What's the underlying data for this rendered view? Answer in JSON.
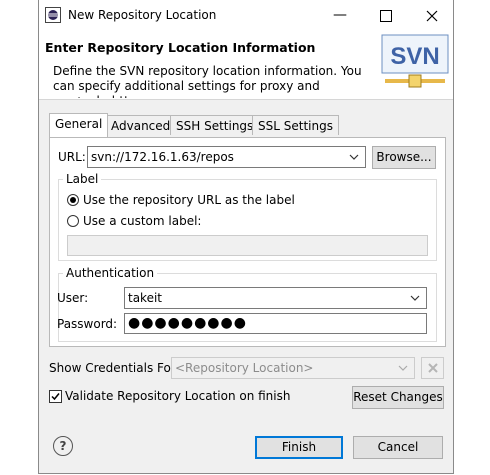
{
  "window": {
    "title": "New Repository Location",
    "minimize_glyph": "—",
    "maximize_glyph": "☐",
    "close_glyph": "✕"
  },
  "header": {
    "title": "Enter Repository Location Information",
    "description": "Define the SVN repository location information. You can specify additional settings for proxy and svn+ssh, https",
    "logo_text": "SVN"
  },
  "tabs": [
    {
      "label": "General"
    },
    {
      "label": "Advanced"
    },
    {
      "label": "SSH Settings"
    },
    {
      "label": "SSL Settings"
    }
  ],
  "url": {
    "label": "URL:",
    "value": "svn://172.16.1.63/repos",
    "browse_label": "Browse..."
  },
  "label_group": {
    "title": "Label",
    "option_repo_url": "Use the repository URL as the label",
    "option_custom": "Use a custom label:",
    "custom_value": ""
  },
  "auth_group": {
    "title": "Authentication",
    "user_label": "User:",
    "user_value": "takeit",
    "password_label": "Password:",
    "password_value": "●●●●●●●●●"
  },
  "credentials": {
    "label": "Show Credentials For:",
    "placeholder": "<Repository Location>"
  },
  "validate": {
    "label": "Validate Repository Location on finish",
    "checked": true
  },
  "buttons": {
    "reset": "Reset Changes",
    "finish": "Finish",
    "cancel": "Cancel",
    "help": "?"
  }
}
